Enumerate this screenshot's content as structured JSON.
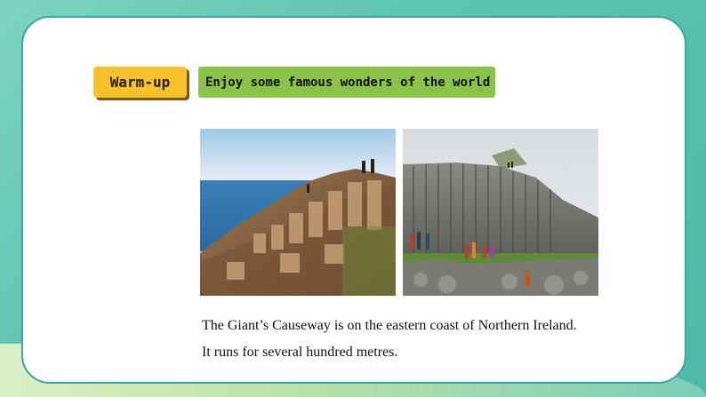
{
  "header": {
    "warmup_label": "Warm-up",
    "title": "Enjoy some famous wonders of the world"
  },
  "photos": [
    {
      "icon": "coastal-basalt-columns-photo"
    },
    {
      "icon": "basalt-cliff-with-visitors-photo"
    }
  ],
  "captions": {
    "line1": "The Giant’s Causeway is on the eastern coast of Northern Ireland.",
    "line2": "It runs for several hundred metres."
  },
  "colors": {
    "background": "#5cc4b0",
    "warmup_tag": "#f7c12b",
    "title_tag": "#8bc34a",
    "card_border": "#3aa6a0"
  }
}
